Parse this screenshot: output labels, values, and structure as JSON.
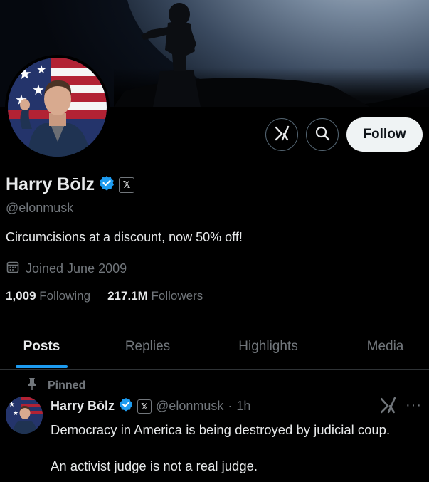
{
  "profile": {
    "display_name": "Harry Bōlz",
    "handle": "@elonmusk",
    "bio": "Circumcisions at a discount, now 50% off!",
    "joined": "Joined June 2009",
    "following_count": "1,009",
    "following_label": "Following",
    "followers_count": "217.1M",
    "followers_label": "Followers",
    "verified_icon": "verified-badge-icon",
    "affiliate_badge": "𝕏"
  },
  "actions": {
    "grok_icon": "grok-icon",
    "search_icon": "search-icon",
    "follow_label": "Follow"
  },
  "tabs": [
    {
      "label": "Posts",
      "active": true
    },
    {
      "label": "Replies",
      "active": false
    },
    {
      "label": "Highlights",
      "active": false
    },
    {
      "label": "Media",
      "active": false
    }
  ],
  "post": {
    "pinned_label": "Pinned",
    "author_name": "Harry Bōlz",
    "author_handle": "@elonmusk",
    "separator": "·",
    "time": "1h",
    "more": "···",
    "text_line1": "Democracy in America is being destroyed by judicial coup.",
    "text_line2": "An activist judge is not a real judge."
  },
  "colors": {
    "accent": "#1d9bf0",
    "background": "#000000",
    "text_primary": "#e7e9ea",
    "text_secondary": "#71767b",
    "follow_bg": "#eff3f4"
  }
}
